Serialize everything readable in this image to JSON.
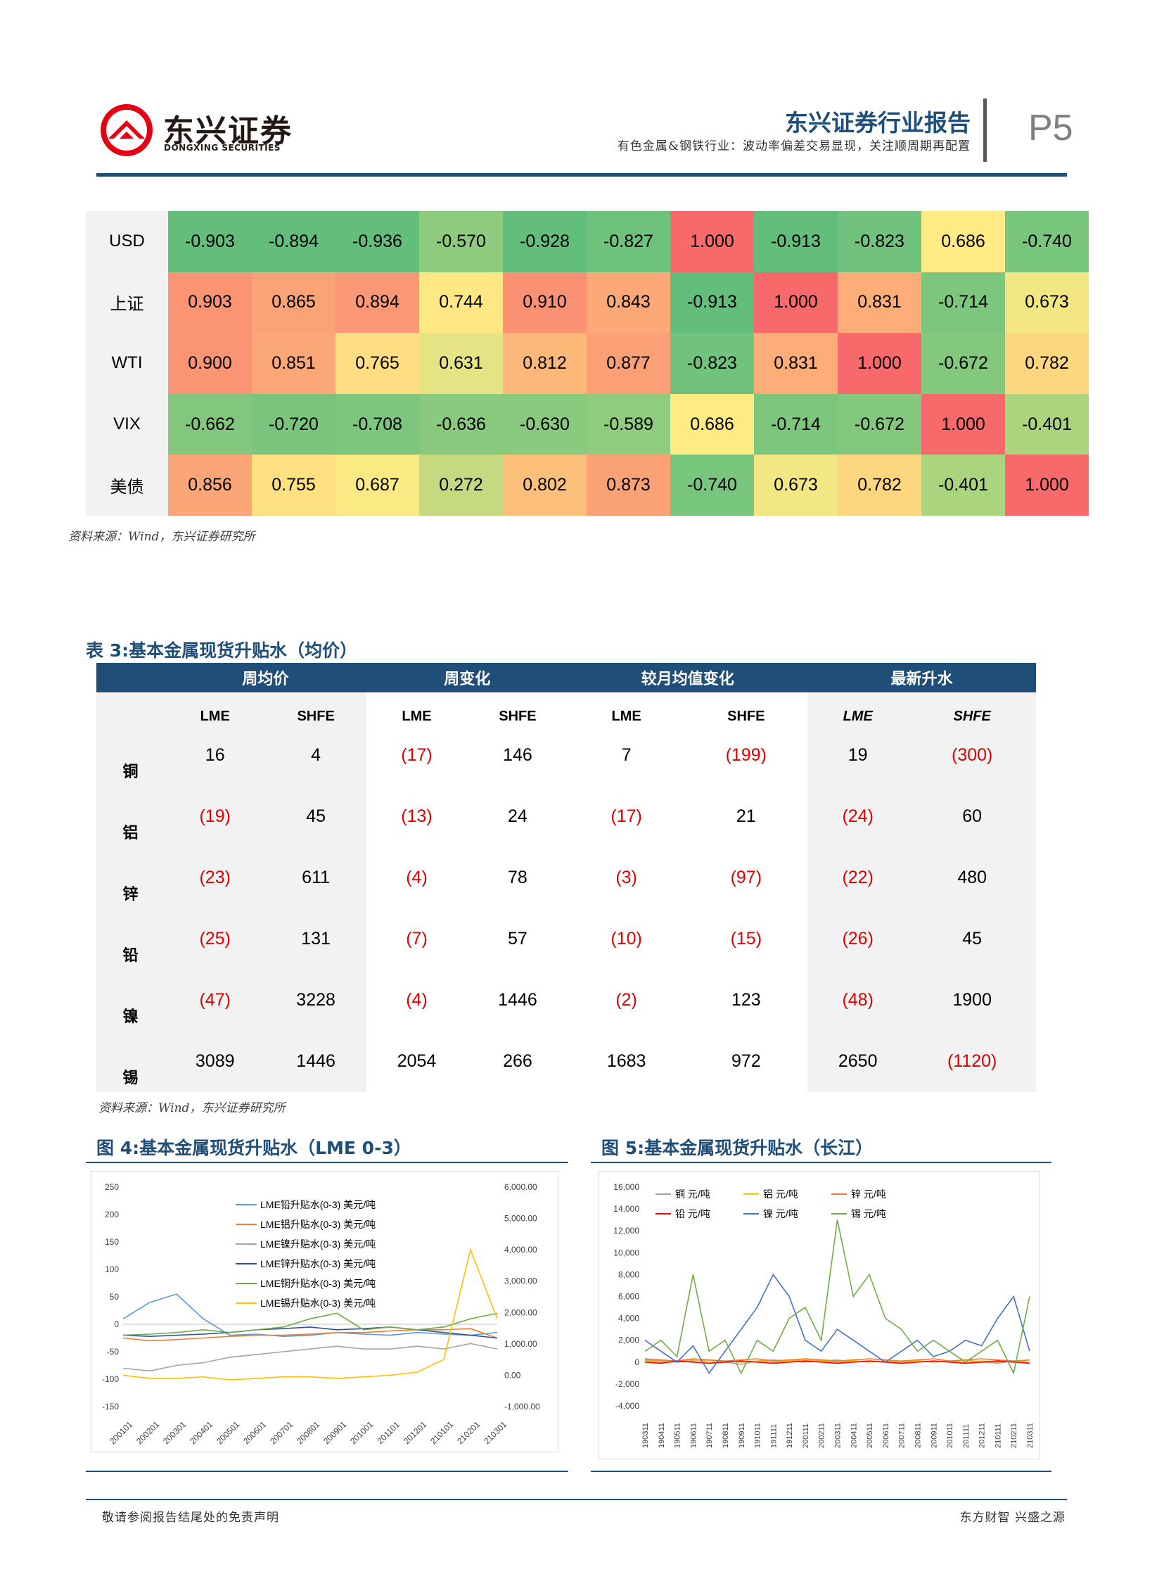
{
  "header": {
    "logo_cn": "东兴证券",
    "logo_en": "DONGXING SECURITIES",
    "report_title": "东兴证券行业报告",
    "report_subtitle": "有色金属&钢铁行业：波动率偏差交易显现，关注顺周期再配置",
    "page_number": "P5"
  },
  "corr_matrix": {
    "rows": [
      {
        "label": "USD",
        "values": [
          "-0.903",
          "-0.894",
          "-0.936",
          "-0.570",
          "-0.928",
          "-0.827",
          "1.000",
          "-0.913",
          "-0.823",
          "0.686",
          "-0.740"
        ],
        "colors": [
          "#63be7b",
          "#63be7b",
          "#63be7b",
          "#8ecb7e",
          "#63be7b",
          "#6fc27c",
          "#f8696b",
          "#63be7b",
          "#70c27c",
          "#ffeb84",
          "#78c57d"
        ]
      },
      {
        "label": "上证",
        "values": [
          "0.903",
          "0.865",
          "0.894",
          "0.744",
          "0.910",
          "0.843",
          "-0.913",
          "1.000",
          "0.831",
          "-0.714",
          "0.673"
        ],
        "colors": [
          "#fa9473",
          "#fba276",
          "#fa9774",
          "#ffe883",
          "#fa9172",
          "#fca977",
          "#63be7b",
          "#f8696b",
          "#fcad78",
          "#7cc67d",
          "#f2e783"
        ]
      },
      {
        "label": "WTI",
        "values": [
          "0.900",
          "0.851",
          "0.765",
          "0.631",
          "0.812",
          "0.877",
          "-0.823",
          "0.831",
          "1.000",
          "-0.672",
          "0.782"
        ],
        "colors": [
          "#fa9573",
          "#fca777",
          "#ffdd82",
          "#e5e383",
          "#fcb879",
          "#fba076",
          "#70c27c",
          "#fcad78",
          "#f8696b",
          "#83c87d",
          "#ffd680"
        ]
      },
      {
        "label": "VIX",
        "values": [
          "-0.662",
          "-0.720",
          "-0.708",
          "-0.636",
          "-0.630",
          "-0.589",
          "0.686",
          "-0.714",
          "-0.672",
          "1.000",
          "-0.401"
        ],
        "colors": [
          "#82c77d",
          "#7ac57d",
          "#7dc67d",
          "#89ca7e",
          "#8aca7e",
          "#8fcc7e",
          "#ffeb84",
          "#7cc67d",
          "#83c87d",
          "#f8696b",
          "#abd47f"
        ]
      },
      {
        "label": "美债",
        "values": [
          "0.856",
          "0.755",
          "0.687",
          "0.272",
          "0.802",
          "0.873",
          "-0.740",
          "0.673",
          "0.782",
          "-0.401",
          "1.000"
        ],
        "colors": [
          "#fca576",
          "#ffe182",
          "#fbe983",
          "#c5da80",
          "#fdc07b",
          "#fba176",
          "#78c57d",
          "#f2e783",
          "#ffd680",
          "#abd47f",
          "#f8696b"
        ]
      }
    ]
  },
  "source_1": "资料来源：Wind，东兴证券研究所",
  "table3": {
    "title": "表 3:基本金属现货升贴水（均价）",
    "groups": [
      "周均价",
      "周变化",
      "较月均值变化",
      "最新升水"
    ],
    "subheaders": [
      "LME",
      "SHFE",
      "LME",
      "SHFE",
      "LME",
      "SHFE",
      "LME",
      "SHFE"
    ],
    "rows": [
      {
        "metal": "铜",
        "values": [
          "16",
          "4",
          "(17)",
          "146",
          "7",
          "(199)",
          "19",
          "(300)"
        ]
      },
      {
        "metal": "铝",
        "values": [
          "(19)",
          "45",
          "(13)",
          "24",
          "(17)",
          "21",
          "(24)",
          "60"
        ]
      },
      {
        "metal": "锌",
        "values": [
          "(23)",
          "611",
          "(4)",
          "78",
          "(3)",
          "(97)",
          "(22)",
          "480"
        ]
      },
      {
        "metal": "铅",
        "values": [
          "(25)",
          "131",
          "(7)",
          "57",
          "(10)",
          "(15)",
          "(26)",
          "45"
        ]
      },
      {
        "metal": "镍",
        "values": [
          "(47)",
          "3228",
          "(4)",
          "1446",
          "(2)",
          "123",
          "(48)",
          "1900"
        ]
      },
      {
        "metal": "锡",
        "values": [
          "3089",
          "1446",
          "2054",
          "266",
          "1683",
          "972",
          "2650",
          "(1120)"
        ]
      }
    ]
  },
  "source_2": "资料来源：Wind，东兴证券研究所",
  "figure4": {
    "title": "图 4:基本金属现货升贴水（LME 0-3）"
  },
  "figure5": {
    "title": "图 5:基本金属现货升贴水（长江）"
  },
  "chart_data": [
    {
      "type": "line",
      "title": "",
      "x": [
        "200101",
        "200201",
        "200301",
        "200401",
        "200501",
        "200601",
        "200701",
        "200801",
        "200901",
        "201001",
        "201101",
        "201201",
        "210101",
        "210201",
        "210301"
      ],
      "ylim": [
        -150,
        250
      ],
      "y_ticks": [
        "250",
        "200",
        "150",
        "100",
        "50",
        "0",
        "-50",
        "-100",
        "-150"
      ],
      "y2lim": [
        -1000,
        6000
      ],
      "y2_ticks": [
        "6,000.00",
        "5,000.00",
        "4,000.00",
        "3,000.00",
        "2,000.00",
        "1,000.00",
        "0.00",
        "-1,000.00"
      ],
      "series": [
        {
          "name": "LME铅升贴水(0-3) 美元/吨",
          "color": "#5b9bd5",
          "axis": "left",
          "values": [
            10,
            40,
            55,
            10,
            -20,
            -18,
            -22,
            -20,
            -15,
            -18,
            -20,
            -15,
            -18,
            -20,
            -15
          ]
        },
        {
          "name": "LME铝升贴水(0-3) 美元/吨",
          "color": "#ed7d31",
          "axis": "left",
          "values": [
            -25,
            -30,
            -28,
            -25,
            -22,
            -20,
            -20,
            -18,
            -15,
            -15,
            -12,
            -10,
            -10,
            -8,
            -25
          ]
        },
        {
          "name": "LME镍升贴水(0-3) 美元/吨",
          "color": "#a5a5a5",
          "axis": "left",
          "values": [
            -80,
            -85,
            -75,
            -70,
            -60,
            -55,
            -50,
            -45,
            -40,
            -45,
            -45,
            -40,
            -45,
            -35,
            -45
          ]
        },
        {
          "name": "LME锌升贴水(0-3) 美元/吨",
          "color": "#2f5597",
          "axis": "left",
          "values": [
            -20,
            -22,
            -20,
            -18,
            -15,
            -10,
            -8,
            -5,
            -10,
            -8,
            -5,
            -10,
            -15,
            -20,
            -25
          ]
        },
        {
          "name": "LME铜升贴水(0-3) 美元/吨",
          "color": "#70ad47",
          "axis": "left",
          "values": [
            -20,
            -18,
            -15,
            -10,
            -15,
            -10,
            -5,
            10,
            20,
            -10,
            -5,
            -10,
            -5,
            10,
            20
          ]
        },
        {
          "name": "LME锡升贴水(0-3) 美元/吨",
          "color": "#ffc000",
          "axis": "right",
          "values": [
            0,
            -100,
            -100,
            -50,
            -150,
            -100,
            -50,
            -50,
            -100,
            -50,
            0,
            100,
            500,
            4000,
            1800
          ]
        }
      ]
    },
    {
      "type": "line",
      "title": "",
      "x": [
        "190311",
        "190411",
        "190511",
        "190611",
        "190711",
        "190811",
        "190911",
        "191011",
        "191111",
        "191211",
        "200111",
        "200211",
        "200311",
        "200411",
        "200511",
        "200611",
        "200711",
        "200811",
        "200911",
        "201011",
        "201111",
        "201211",
        "210111",
        "210211",
        "210311"
      ],
      "ylim": [
        -4000,
        16000
      ],
      "y_ticks": [
        "16,000",
        "14,000",
        "12,000",
        "10,000",
        "8,000",
        "6,000",
        "4,000",
        "2,000",
        "0",
        "-2,000",
        "-4,000"
      ],
      "series": [
        {
          "name": "铜 元/吨",
          "color": "#a5a5a5",
          "values": [
            200,
            100,
            0,
            100,
            200,
            0,
            -200,
            100,
            200,
            100,
            0,
            100,
            200,
            0,
            100,
            0,
            -100,
            100,
            0,
            100,
            200,
            0,
            -100,
            100,
            0
          ]
        },
        {
          "name": "铝 元/吨",
          "color": "#ffc000",
          "values": [
            100,
            0,
            100,
            200,
            0,
            100,
            0,
            100,
            0,
            100,
            200,
            100,
            0,
            100,
            0,
            100,
            0,
            100,
            0,
            100,
            0,
            100,
            0,
            100,
            0
          ]
        },
        {
          "name": "锌 元/吨",
          "color": "#ed7d31",
          "values": [
            300,
            200,
            100,
            300,
            200,
            100,
            200,
            300,
            100,
            200,
            300,
            200,
            100,
            200,
            300,
            200,
            100,
            200,
            300,
            100,
            200,
            300,
            200,
            100,
            200
          ]
        },
        {
          "name": "铅 元/吨",
          "color": "#ff0000",
          "values": [
            0,
            -100,
            100,
            0,
            -100,
            0,
            100,
            0,
            -100,
            0,
            100,
            0,
            -100,
            0,
            100,
            0,
            -100,
            0,
            100,
            0,
            -100,
            0,
            100,
            0,
            -100
          ]
        },
        {
          "name": "镍 元/吨",
          "color": "#4472c4",
          "values": [
            2000,
            1000,
            0,
            1500,
            -1000,
            1000,
            3000,
            5000,
            8000,
            6000,
            2000,
            1000,
            3000,
            2000,
            1000,
            0,
            1000,
            2000,
            500,
            1000,
            2000,
            1500,
            4000,
            6000,
            1000
          ]
        },
        {
          "name": "锡 元/吨",
          "color": "#70ad47",
          "values": [
            1000,
            2000,
            500,
            8000,
            1000,
            2000,
            -1000,
            2000,
            1000,
            4000,
            5000,
            2000,
            13000,
            6000,
            8000,
            4000,
            3000,
            1000,
            2000,
            1000,
            0,
            1000,
            2000,
            -1000,
            6000
          ]
        }
      ]
    }
  ],
  "footer": {
    "left": "敬请参阅报告结尾处的免责声明",
    "right": "东方财智 兴盛之源"
  }
}
